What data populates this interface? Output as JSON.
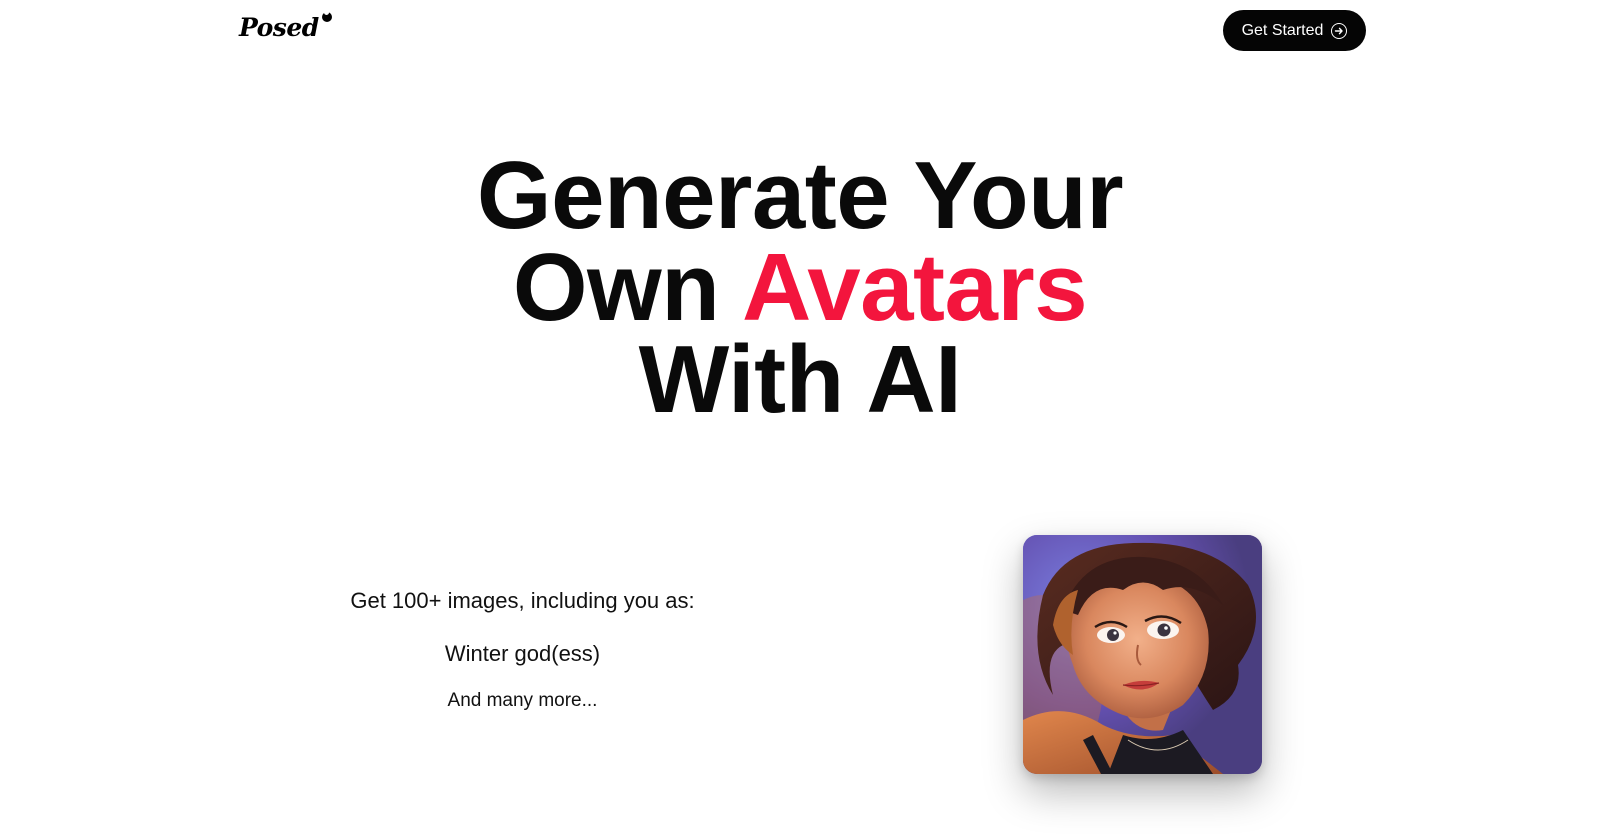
{
  "header": {
    "logo_text": "Posed",
    "cta_label": "Get Started",
    "cta_icon": "arrow-right-circle-icon"
  },
  "hero": {
    "line1": "Generate Your",
    "line2_prefix": "Own ",
    "line2_accent": "Avatars",
    "line3": "With AI",
    "accent_color": "#f3153d"
  },
  "offer": {
    "intro": "Get 100+ images, including you as:",
    "style": "Winter god(ess)",
    "more": "And many more..."
  },
  "avatar": {
    "description_icon": "avatar-portrait"
  }
}
